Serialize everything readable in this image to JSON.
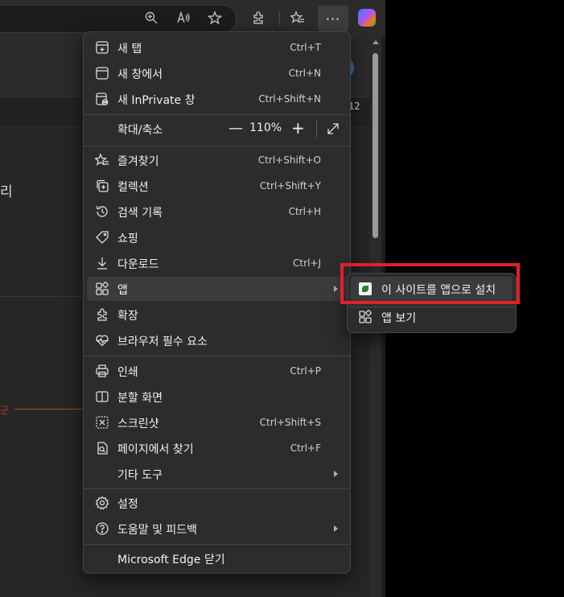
{
  "page": {
    "partial_text_left": "리",
    "partial_text_right": "12",
    "partial_red_text": "군"
  },
  "toolbar": {
    "more_label": "···",
    "icons": [
      "zoom-in-icon",
      "read-aloud-icon",
      "favorite-star-icon",
      "extensions-icon",
      "favorites-icon",
      "copilot-icon"
    ]
  },
  "menu": {
    "items": [
      {
        "label": "새 탭",
        "shortcut": "Ctrl+T",
        "icon": "new-tab-icon"
      },
      {
        "label": "새 창에서",
        "shortcut": "Ctrl+N",
        "icon": "new-window-icon"
      },
      {
        "label": "새 InPrivate 창",
        "shortcut": "Ctrl+Shift+N",
        "icon": "inprivate-icon"
      },
      {
        "label": "확대/축소",
        "shortcut": "",
        "icon": ""
      },
      {
        "label": "즐겨찾기",
        "shortcut": "Ctrl+Shift+O",
        "icon": "favorites-icon"
      },
      {
        "label": "컬렉션",
        "shortcut": "Ctrl+Shift+Y",
        "icon": "collections-icon"
      },
      {
        "label": "검색 기록",
        "shortcut": "Ctrl+H",
        "icon": "history-icon"
      },
      {
        "label": "쇼핑",
        "shortcut": "",
        "icon": "shopping-tag-icon"
      },
      {
        "label": "다운로드",
        "shortcut": "Ctrl+J",
        "icon": "download-icon"
      },
      {
        "label": "앱",
        "shortcut": "",
        "icon": "apps-icon"
      },
      {
        "label": "확장",
        "shortcut": "",
        "icon": "extensions-icon"
      },
      {
        "label": "브라우저 필수 요소",
        "shortcut": "",
        "icon": "heart-pulse-icon"
      },
      {
        "label": "인쇄",
        "shortcut": "Ctrl+P",
        "icon": "print-icon"
      },
      {
        "label": "분할 화면",
        "shortcut": "",
        "icon": "split-screen-icon"
      },
      {
        "label": "스크린샷",
        "shortcut": "Ctrl+Shift+S",
        "icon": "screenshot-icon"
      },
      {
        "label": "페이지에서 찾기",
        "shortcut": "Ctrl+F",
        "icon": "find-on-page-icon"
      },
      {
        "label": "기타 도구",
        "shortcut": "",
        "icon": ""
      },
      {
        "label": "설정",
        "shortcut": "",
        "icon": "settings-gear-icon"
      },
      {
        "label": "도움말 및 피드백",
        "shortcut": "",
        "icon": "help-icon"
      },
      {
        "label": "Microsoft Edge 닫기",
        "shortcut": "",
        "icon": ""
      }
    ],
    "zoom": {
      "minus": "—",
      "value": "110%",
      "plus": "+"
    }
  },
  "submenu": {
    "items": [
      {
        "label": "이 사이트를 앱으로 설치",
        "icon": "site-app-icon"
      },
      {
        "label": "앱 보기",
        "icon": "apps-icon"
      }
    ]
  },
  "colors": {
    "highlight": "#e0202a",
    "menu_bg": "#2c2c2c",
    "hover_bg": "#3b3b3b"
  }
}
